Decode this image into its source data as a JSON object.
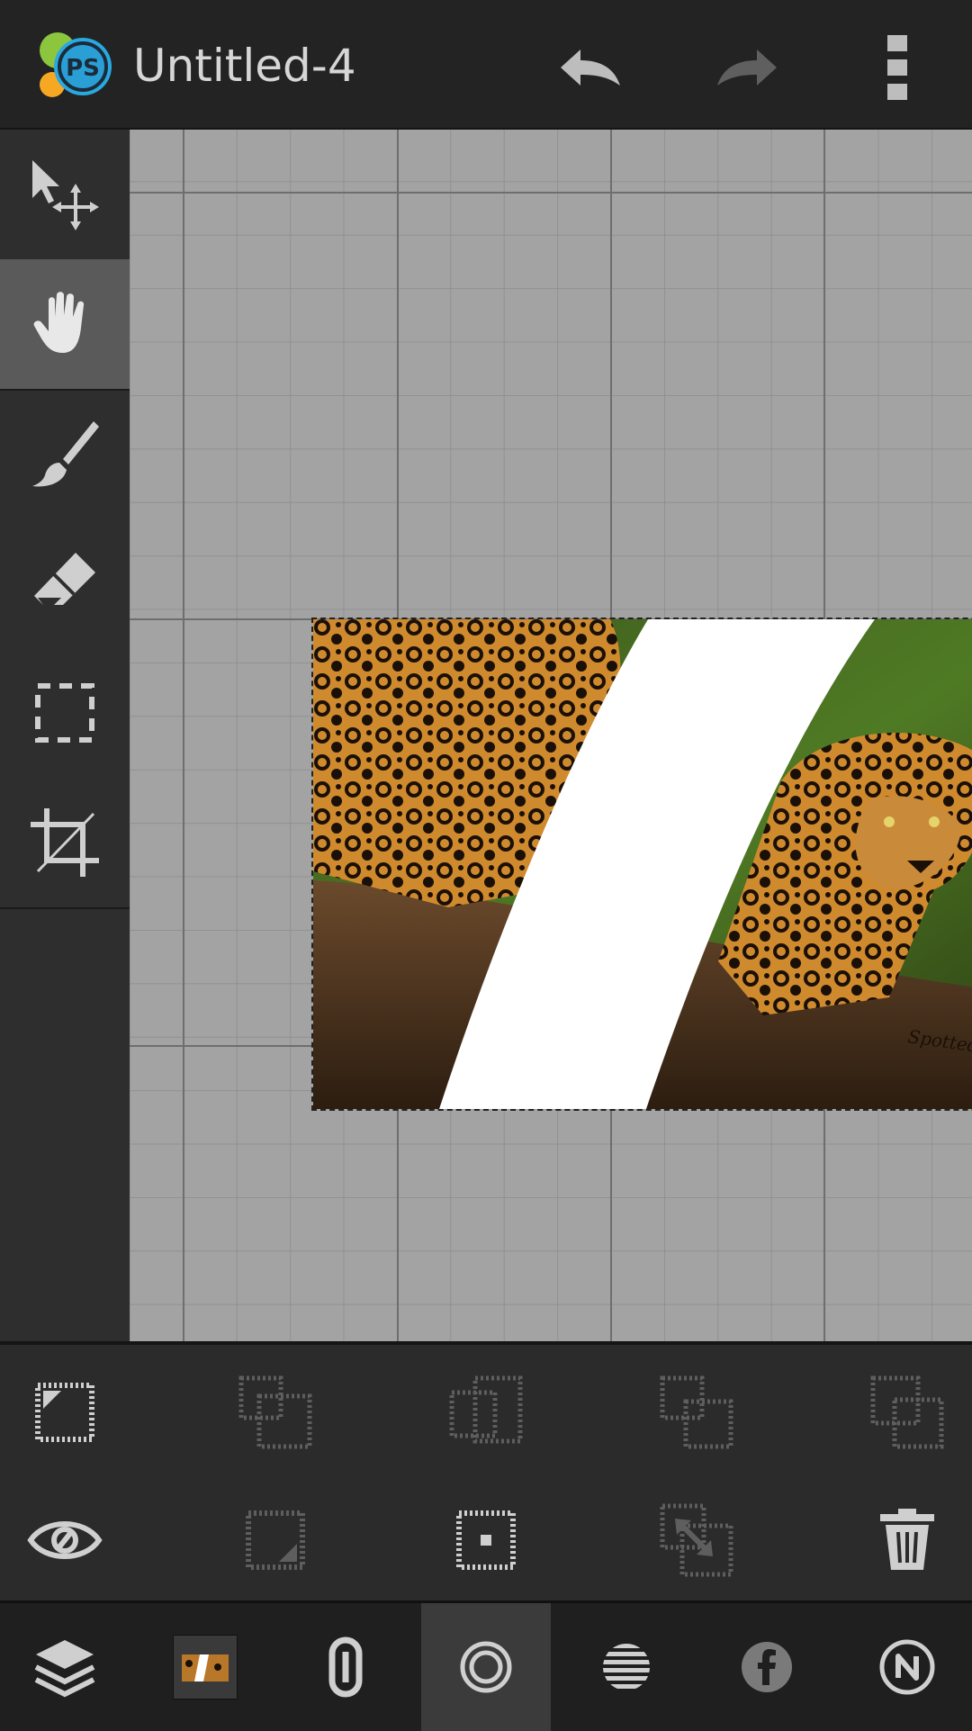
{
  "app": {
    "title": "Untitled-4",
    "logo_text": "PS"
  },
  "toolbar": {
    "undo": "undo-icon",
    "redo": "redo-icon",
    "menu": "overflow-menu-icon"
  },
  "tools": [
    {
      "name": "move-tool",
      "icon": "move-icon",
      "active": false
    },
    {
      "name": "pan-tool",
      "icon": "hand-icon",
      "active": true
    },
    {
      "name": "brush-tool",
      "icon": "brush-icon",
      "active": false
    },
    {
      "name": "eraser-tool",
      "icon": "eraser-icon",
      "active": false
    },
    {
      "name": "selection-tool",
      "icon": "marquee-icon",
      "active": false
    },
    {
      "name": "crop-tool",
      "icon": "crop-icon",
      "active": false
    }
  ],
  "colors": {
    "canvas_bg": "#9e9e9e",
    "panel_bg": "#2b2b2b",
    "active_tool_bg": "#5a5a5a",
    "icon": "#cfcfcf",
    "icon_disabled": "#6a6a6a",
    "logo_blue": "#29a9e0",
    "logo_green": "#8cc63f",
    "logo_orange": "#f7a823"
  },
  "layer_panel": {
    "row1": [
      "select-corner-icon",
      "layer-copy-icon",
      "layer-merge-icon",
      "layer-arrange-icon",
      "layer-duplicate-icon"
    ],
    "row2": [
      "visibility-icon",
      "resize-corner-icon",
      "center-icon",
      "scale-icon",
      "trash-icon"
    ]
  },
  "bottom_bar": [
    "layers-icon",
    "layer-thumbnail",
    "link-icon",
    "opacity-icon",
    "blend-icon",
    "facebook-icon",
    "n-icon"
  ]
}
